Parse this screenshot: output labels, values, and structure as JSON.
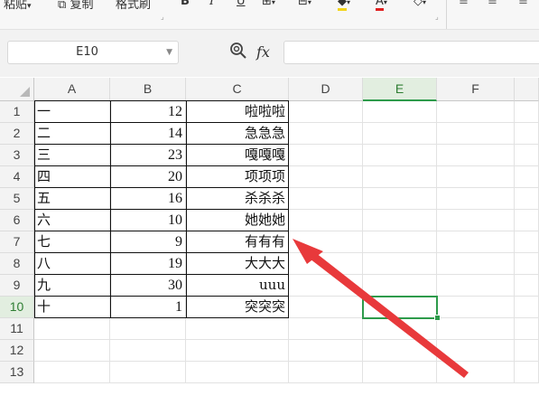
{
  "toolbar": {
    "paste_label": "粘贴",
    "copy_label": "复制",
    "format_painter_label": "格式刷"
  },
  "formula_bar": {
    "cell_reference": "E10",
    "fx_label": "fx",
    "content": ""
  },
  "sheet": {
    "columns": [
      "A",
      "B",
      "C",
      "D",
      "E",
      "F"
    ],
    "rows": [
      "1",
      "2",
      "3",
      "4",
      "5",
      "6",
      "7",
      "8",
      "9",
      "10",
      "11",
      "12",
      "13"
    ],
    "selected_cell": "E10",
    "data": [
      [
        "一",
        "12",
        "啦啦啦"
      ],
      [
        "二",
        "14",
        "急急急"
      ],
      [
        "三",
        "23",
        "嘎嘎嘎"
      ],
      [
        "四",
        "20",
        "项项项"
      ],
      [
        "五",
        "16",
        "杀杀杀"
      ],
      [
        "六",
        "10",
        "她她她"
      ],
      [
        "七",
        "9",
        "有有有"
      ],
      [
        "八",
        "19",
        "大大大"
      ],
      [
        "九",
        "30",
        "uuu"
      ],
      [
        "十",
        "1",
        "突突突"
      ]
    ]
  },
  "colors": {
    "accent": "#2e9b4b",
    "annotation_arrow": "#e8393b"
  }
}
